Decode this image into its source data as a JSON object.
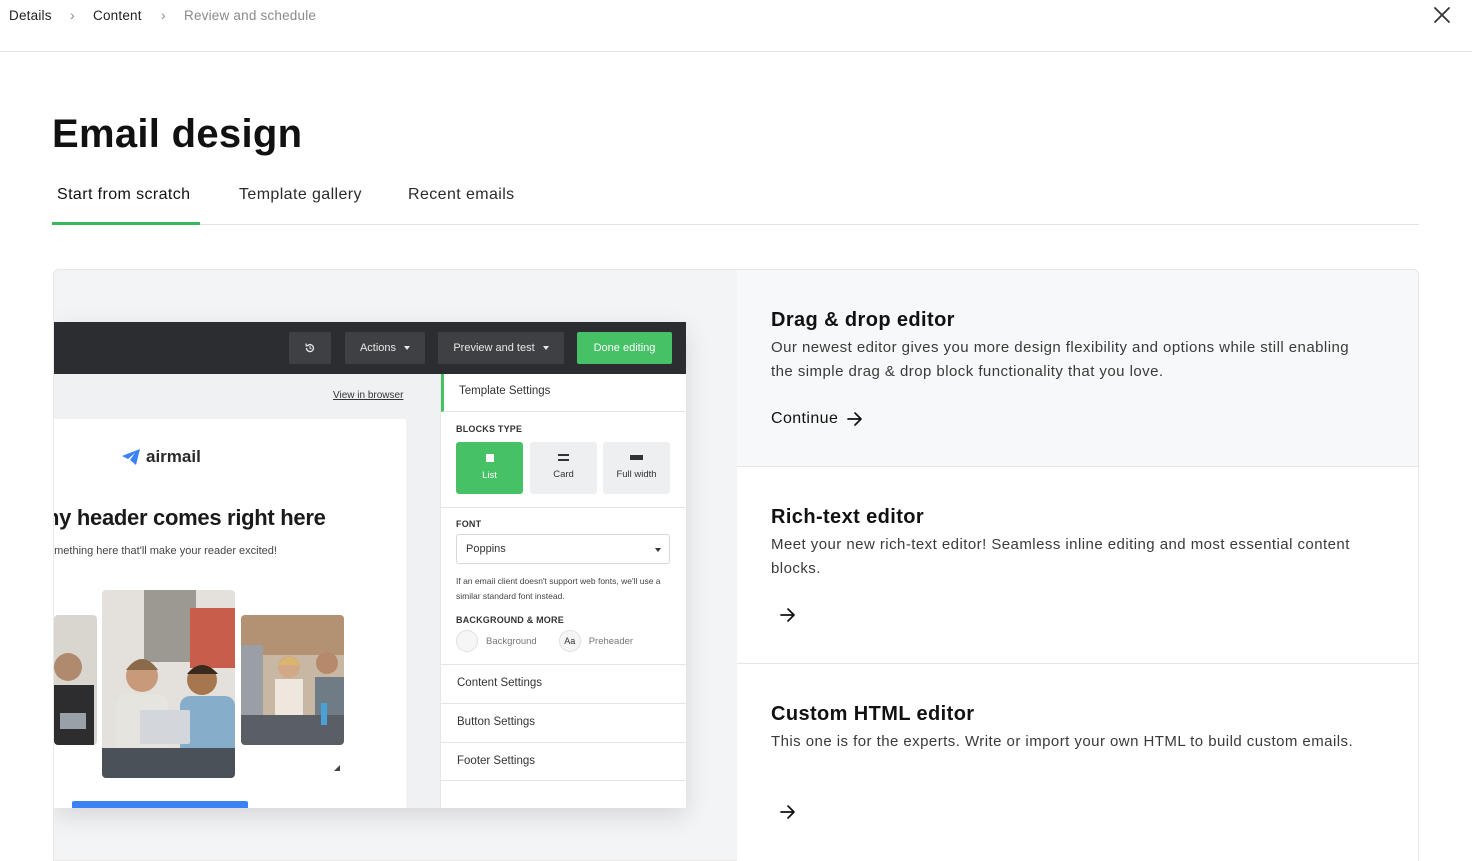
{
  "breadcrumb": {
    "items": [
      {
        "label": "Details"
      },
      {
        "label": "Content"
      },
      {
        "label": "Review and schedule"
      }
    ]
  },
  "page": {
    "title": "Email design"
  },
  "tabs": [
    {
      "label": "Start from scratch",
      "active": true
    },
    {
      "label": "Template gallery",
      "active": false
    },
    {
      "label": "Recent emails",
      "active": false
    }
  ],
  "preview": {
    "toolbar": {
      "actions_label": "Actions",
      "preview_label": "Preview and test",
      "done_label": "Done editing"
    },
    "email": {
      "view_in_browser": "View in browser",
      "logo_text": "airmail",
      "header": "ny header comes right here",
      "subtext": "omething here that'll make your reader excited!"
    },
    "sidebar": {
      "template_settings": "Template Settings",
      "blocks_type_label": "BLOCKS TYPE",
      "blocks": [
        {
          "label": "List",
          "selected": true
        },
        {
          "label": "Card",
          "selected": false
        },
        {
          "label": "Full width",
          "selected": false
        }
      ],
      "font_label": "FONT",
      "font_value": "Poppins",
      "font_note": "If an email client doesn't support web fonts, we'll use a similar standard font instead.",
      "background_label": "BACKGROUND & MORE",
      "background_swatch": "Background",
      "preheader_badge": "Aa",
      "preheader_swatch": "Preheader",
      "rows": [
        {
          "label": "Content Settings"
        },
        {
          "label": "Button Settings"
        },
        {
          "label": "Footer Settings"
        }
      ]
    }
  },
  "options": [
    {
      "title": "Drag & drop editor",
      "description": "Our newest editor gives you more design flexibility and options while still enabling the simple drag & drop block functionality that you love.",
      "link": "Continue"
    },
    {
      "title": "Rich-text editor",
      "description": "Meet your new rich-text editor! Seamless inline editing and most essential content blocks.",
      "link": ""
    },
    {
      "title": "Custom HTML editor",
      "description": "This one is for the experts. Write or import your own HTML to build custom emails.",
      "link": ""
    }
  ],
  "colors": {
    "accent": "#3db55e",
    "primary_button": "#47c166",
    "toolbar": "#2b2d30",
    "email_button": "#3b82f6"
  },
  "icons": {
    "close": "close-icon",
    "chevron": "chevron-right-icon",
    "arrow": "arrow-right-icon"
  }
}
